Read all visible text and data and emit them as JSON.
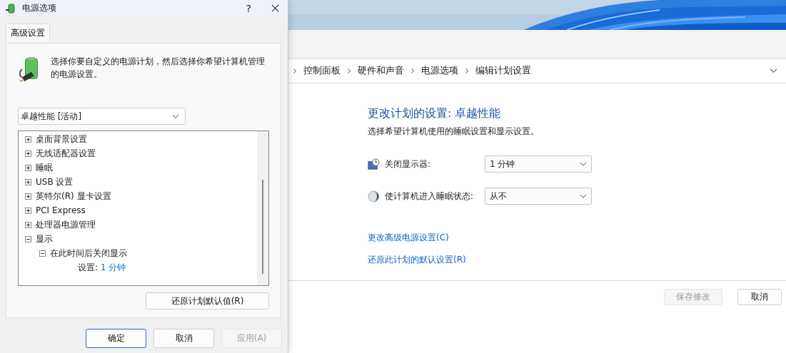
{
  "main_window": {
    "breadcrumb": [
      {
        "label": "控制面板"
      },
      {
        "label": "硬件和声音"
      },
      {
        "label": "电源选项"
      },
      {
        "label": "编辑计划设置"
      }
    ],
    "title": "更改计划的设置: 卓越性能",
    "subtitle": "选择希望计算机使用的睡眠设置和显示设置。",
    "settings": [
      {
        "kind": "display",
        "label": "关闭显示器:",
        "value": "1 分钟"
      },
      {
        "kind": "sleep",
        "label": "使计算机进入睡眠状态:",
        "value": "从不"
      }
    ],
    "links": [
      "更改高级电源设置(C)",
      "还原此计划的默认设置(R)"
    ],
    "buttons": [
      {
        "label": "保存修改",
        "disabled": true
      },
      {
        "label": "取消",
        "disabled": false
      }
    ]
  },
  "dialog": {
    "title": "电源选项",
    "help_button": "?",
    "tabs": [
      {
        "label": "高级设置",
        "selected": true
      }
    ],
    "description": "选择你要自定义的电源计划，然后选择你希望计算机管理的电源设置。",
    "plan_select": {
      "value": "卓越性能 [活动]"
    },
    "tree": [
      {
        "label": "桌面背景设置",
        "expanded": false
      },
      {
        "label": "无线适配器设置",
        "expanded": false
      },
      {
        "label": "睡眠",
        "expanded": false
      },
      {
        "label": "USB 设置",
        "expanded": false
      },
      {
        "label": "英特尔(R) 显卡设置",
        "expanded": false
      },
      {
        "label": "PCI Express",
        "expanded": false
      },
      {
        "label": "处理器电源管理",
        "expanded": false
      },
      {
        "label": "显示",
        "expanded": true,
        "children": [
          {
            "label": "在此时间后关闭显示",
            "expanded": true,
            "children": [
              {
                "kind": "setting",
                "label": "设置:",
                "value": "1 分钟"
              }
            ]
          }
        ]
      }
    ],
    "restore_button": "还原计划默认值(R)",
    "buttons": [
      {
        "label": "确定",
        "default": true,
        "disabled": false
      },
      {
        "label": "取消",
        "default": false,
        "disabled": false
      },
      {
        "label": "应用(A)",
        "default": false,
        "disabled": true
      }
    ]
  }
}
